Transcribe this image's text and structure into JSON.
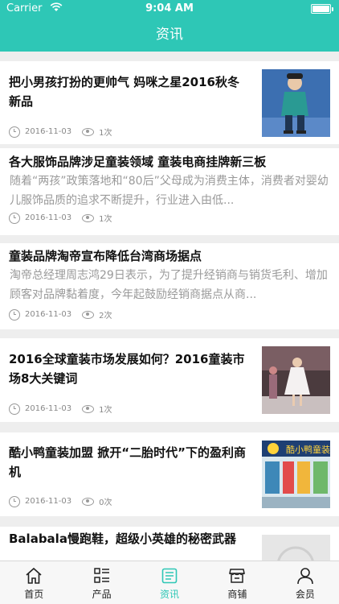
{
  "status_bar": {
    "carrier": "Carrier",
    "time": "9:04 AM"
  },
  "header": {
    "title": "资讯"
  },
  "articles": [
    {
      "title": "把小男孩打扮的更帅气 妈咪之星2016秋冬新品",
      "summary": "",
      "date": "2016-11-03",
      "views": "1次",
      "has_thumbnail": true
    },
    {
      "title": "各大服饰品牌涉足童装领域 童装电商挂牌新三板",
      "summary": "随着“两孩”政策落地和“80后”父母成为消费主体，消费者对婴幼儿服饰品质的追求不断提升，行业进入由低...",
      "date": "2016-11-03",
      "views": "1次",
      "has_thumbnail": false
    },
    {
      "title": "童装品牌淘帝宣布降低台湾商场据点",
      "summary": "淘帝总经理周志鸿29日表示，为了提升经销商与销货毛利、增加顾客对品牌黏着度，今年起鼓励经销商据点从商...",
      "date": "2016-11-03",
      "views": "2次",
      "has_thumbnail": false
    },
    {
      "title": "2016全球童装市场发展如何？2016童装市场8大关键词",
      "summary": "",
      "date": "2016-11-03",
      "views": "1次",
      "has_thumbnail": true
    },
    {
      "title": "酷小鸭童装加盟 掀开“二胎时代”下的盈利商机",
      "summary": "",
      "date": "2016-11-03",
      "views": "0次",
      "has_thumbnail": true,
      "thumb_sign": "酷小鸭童装"
    },
    {
      "title": "Balabala慢跑鞋，超级小英雄的秘密武器",
      "summary": "",
      "date": "",
      "views": "",
      "has_thumbnail": true
    }
  ],
  "tab_bar": {
    "items": [
      {
        "label": "首页",
        "icon": "home-icon",
        "active": false
      },
      {
        "label": "产品",
        "icon": "grid-list-icon",
        "active": false
      },
      {
        "label": "资讯",
        "icon": "news-icon",
        "active": true
      },
      {
        "label": "商铺",
        "icon": "store-icon",
        "active": false
      },
      {
        "label": "会员",
        "icon": "user-icon",
        "active": false
      }
    ]
  },
  "colors": {
    "brand": "#2ec7b6",
    "active_tab": "#2ec7b6",
    "background": "#eeeeee"
  }
}
